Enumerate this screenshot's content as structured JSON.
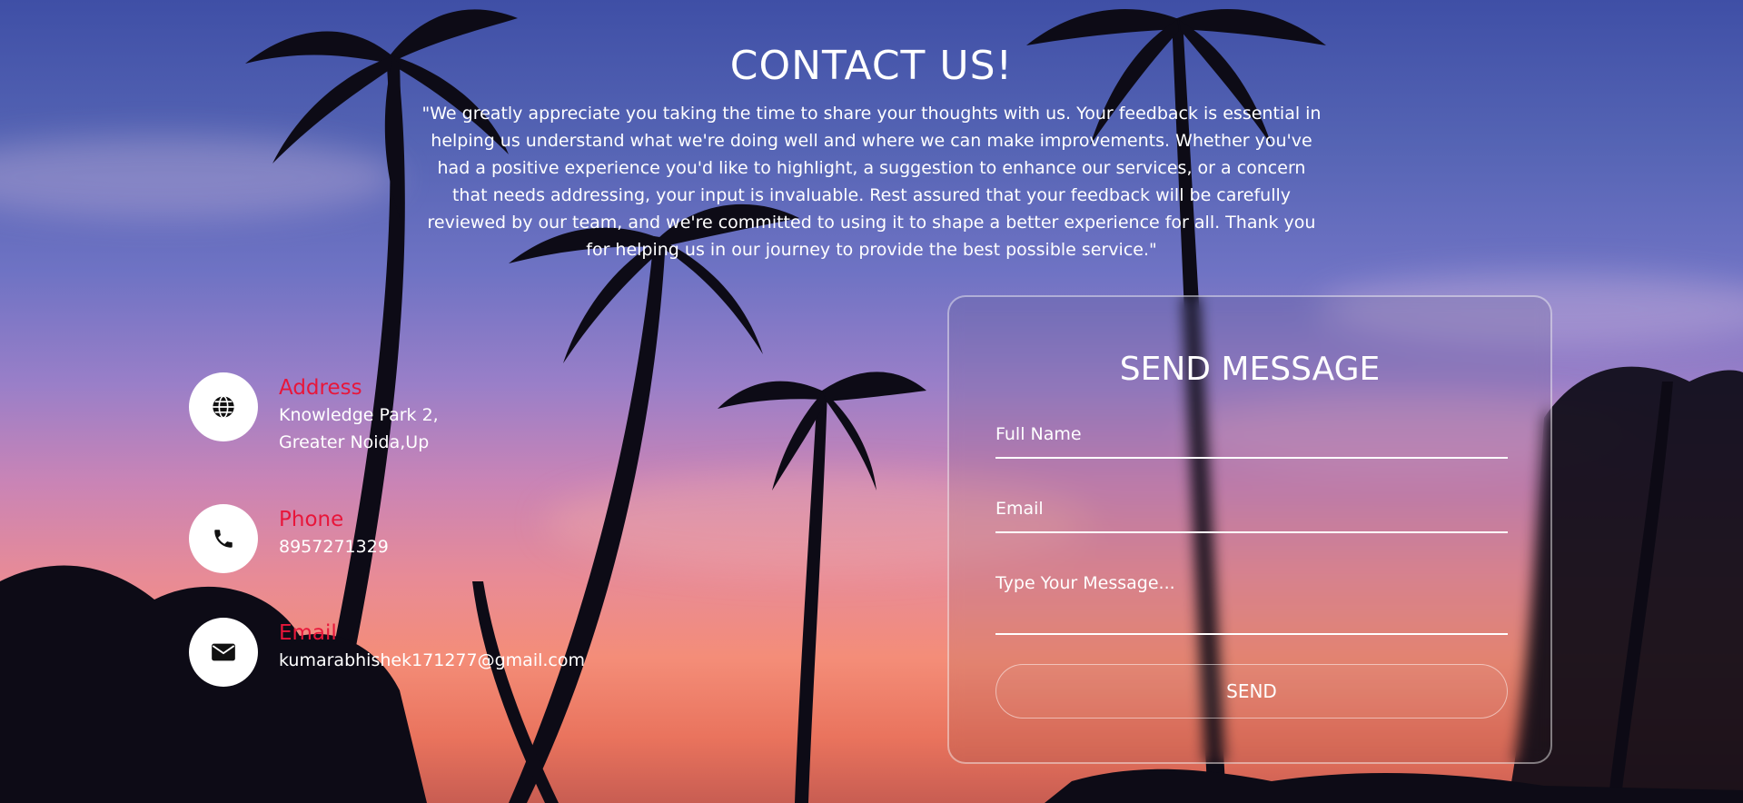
{
  "header": {
    "title": "CONTACT US!",
    "intro": "\"We greatly appreciate you taking the time to share your thoughts with us. Your feedback is essential in helping us understand what we're doing well and where we can make improvements. Whether you've had a positive experience you'd like to highlight, a suggestion to enhance our services, or a concern that needs addressing, your input is invaluable. Rest assured that your feedback will be carefully reviewed by our team, and we're committed to using it to shape a better experience for all. Thank you for helping us in our journey to provide the best possible service.\""
  },
  "contact": {
    "address": {
      "icon": "globe-icon",
      "label": "Address",
      "line1": "Knowledge Park 2,",
      "line2": "Greater Noida,Up"
    },
    "phone": {
      "icon": "phone-icon",
      "label": "Phone",
      "value": "8957271329"
    },
    "email": {
      "icon": "envelope-icon",
      "label": "Email",
      "value": "kumarabhishek171277@gmail.com"
    }
  },
  "form": {
    "title": "SEND MESSAGE",
    "full_name_placeholder": "Full Name",
    "email_placeholder": "Email",
    "message_placeholder": "Type Your Message...",
    "send_label": "SEND"
  },
  "colors": {
    "accent_label": "#e8163a",
    "text": "#ffffff",
    "sky_top": "#3f4fa6",
    "sky_bottom": "#e9735d"
  }
}
